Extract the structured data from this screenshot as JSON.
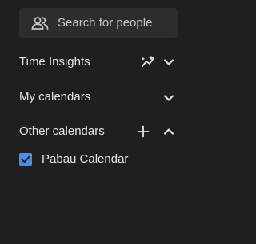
{
  "search": {
    "placeholder": "Search for people",
    "icon": "people-icon"
  },
  "sections": {
    "time_insights": {
      "label": "Time Insights",
      "icons": [
        "insights-icon",
        "chevron-down-icon"
      ]
    },
    "my_calendars": {
      "label": "My calendars",
      "icons": [
        "chevron-down-icon"
      ]
    },
    "other_calendars": {
      "label": "Other calendars",
      "icons": [
        "add-icon",
        "chevron-up-icon"
      ],
      "items": [
        {
          "label": "Pabau Calendar",
          "checked": true,
          "color": "#4b8ee6"
        }
      ]
    }
  },
  "colors": {
    "background": "#1f1f1f",
    "search_background": "#2d2d2d",
    "text": "#e3e3e3",
    "muted_text": "#c4c7c5",
    "checkbox": "#4b8ee6"
  }
}
